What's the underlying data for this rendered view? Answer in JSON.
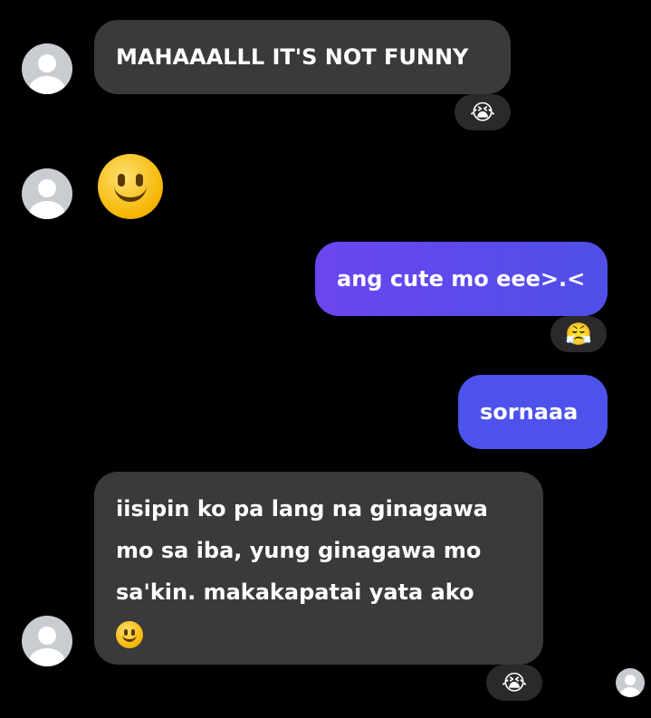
{
  "messages": [
    {
      "text": "MAHAAALLL IT'S NOT FUNNY",
      "reaction": "😭"
    },
    {
      "emoji": "smiling-face"
    },
    {
      "text": "ang cute mo eee>.<",
      "reaction": "😤"
    },
    {
      "text": "sornaaa"
    },
    {
      "lines": [
        "iisipin ko pa lang na ginagawa",
        "mo sa iba, yung ginagawa mo",
        "sa'kin. makakapatai yata ako"
      ],
      "reaction": "😭"
    }
  ],
  "colors": {
    "background": "#000000",
    "incoming_bubble": "#3a3a3c",
    "outgoing_bubble": "#5b4cf0",
    "reaction_pill": "#2a2a2c"
  }
}
